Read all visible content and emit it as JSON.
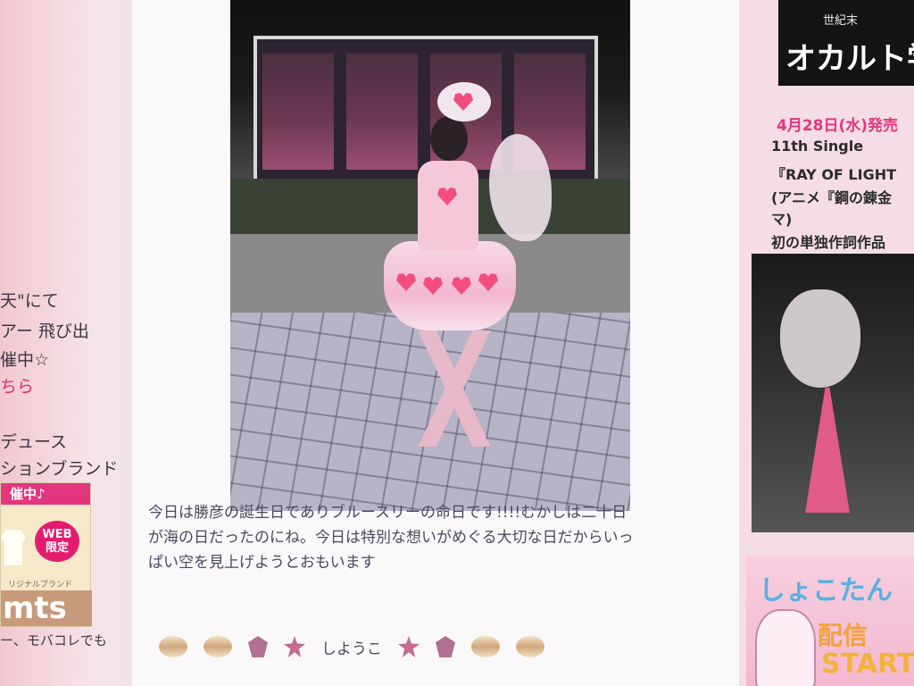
{
  "left_sidebar": {
    "lines": [
      {
        "text": "天\"にて"
      },
      {
        "text": "アー 飛び出"
      },
      {
        "text": "催中☆"
      },
      {
        "text": "ちら",
        "link": true
      },
      {
        "text": "デュース"
      },
      {
        "text": "ションブランド"
      }
    ],
    "banner": {
      "header": "催中♪",
      "badge_line1": "WEB",
      "badge_line2": "限定",
      "subtext": "リジナルブランド",
      "brand": "mts"
    },
    "footer": "ー、モバコレでも"
  },
  "post": {
    "caption_lines": [
      "今日は勝彦の誕生日でありブルースリーの命日です!!!!むかしは二十日",
      "が海の日だったのにね。今日は特別な想いがめぐる大切な日だからいっ",
      "ぱい空を見上げようとおもいます"
    ],
    "signature": "しようこ",
    "emoji_icons": [
      "sun-icon",
      "sun-icon",
      "face-icon",
      "star-icon",
      "star-icon",
      "face-icon",
      "sun-icon",
      "sun-icon"
    ]
  },
  "right_sidebar": {
    "top_ad": {
      "small": "世紀末",
      "big": "オカルト学"
    },
    "release": {
      "date": "4月28日(水)発売",
      "lines": [
        "11th Single",
        "『RAY OF LIGHT",
        "(アニメ『鋼の錬金",
        "マ)",
        "初の単独作詞作品"
      ]
    },
    "bottom_ad": {
      "title": "しょこたん",
      "haishin": "配信",
      "start": "START"
    }
  },
  "colors": {
    "accent_pink": "#e4357f",
    "page_background": "#f3e9ee"
  }
}
